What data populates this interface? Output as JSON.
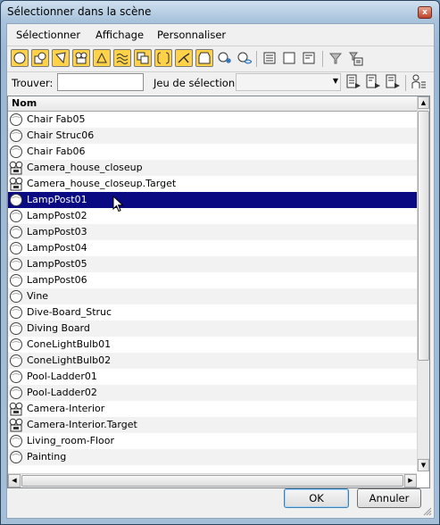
{
  "window": {
    "title": "Sélectionner dans la scène",
    "close_label": "x"
  },
  "menu": [
    {
      "label": "Sélectionner"
    },
    {
      "label": "Affichage"
    },
    {
      "label": "Personnaliser"
    }
  ],
  "findbar": {
    "find_label": "Trouver:",
    "find_value": "",
    "selset_label": "Jeu de sélection:",
    "selset_value": ""
  },
  "list": {
    "column_header": "Nom",
    "rows": [
      {
        "label": "Chair Fab05",
        "icon": "sphere-icon"
      },
      {
        "label": "Chair Struc06",
        "icon": "sphere-icon"
      },
      {
        "label": "Chair Fab06",
        "icon": "sphere-icon"
      },
      {
        "label": "Camera_house_closeup",
        "icon": "camera-icon"
      },
      {
        "label": "Camera_house_closeup.Target",
        "icon": "camera-icon"
      },
      {
        "label": "LampPost01",
        "icon": "sphere-icon",
        "selected": true
      },
      {
        "label": "LampPost02",
        "icon": "sphere-icon"
      },
      {
        "label": "LampPost03",
        "icon": "sphere-icon"
      },
      {
        "label": "LampPost04",
        "icon": "sphere-icon"
      },
      {
        "label": "LampPost05",
        "icon": "sphere-icon"
      },
      {
        "label": "LampPost06",
        "icon": "sphere-icon"
      },
      {
        "label": "Vine",
        "icon": "sphere-icon"
      },
      {
        "label": "Dive-Board_Struc",
        "icon": "sphere-icon"
      },
      {
        "label": "Diving Board",
        "icon": "sphere-icon"
      },
      {
        "label": "ConeLightBulb01",
        "icon": "sphere-icon"
      },
      {
        "label": "ConeLightBulb02",
        "icon": "sphere-icon"
      },
      {
        "label": "Pool-Ladder01",
        "icon": "sphere-icon"
      },
      {
        "label": "Pool-Ladder02",
        "icon": "sphere-icon"
      },
      {
        "label": "Camera-Interior",
        "icon": "camera-icon"
      },
      {
        "label": "Camera-Interior.Target",
        "icon": "camera-icon"
      },
      {
        "label": "Living_room-Floor",
        "icon": "sphere-icon"
      },
      {
        "label": "Painting",
        "icon": "sphere-icon"
      }
    ]
  },
  "buttons": {
    "ok": "OK",
    "cancel": "Annuler"
  },
  "colors": {
    "selection": "#0a0a82",
    "toolbar_active": "#ffd24a"
  }
}
